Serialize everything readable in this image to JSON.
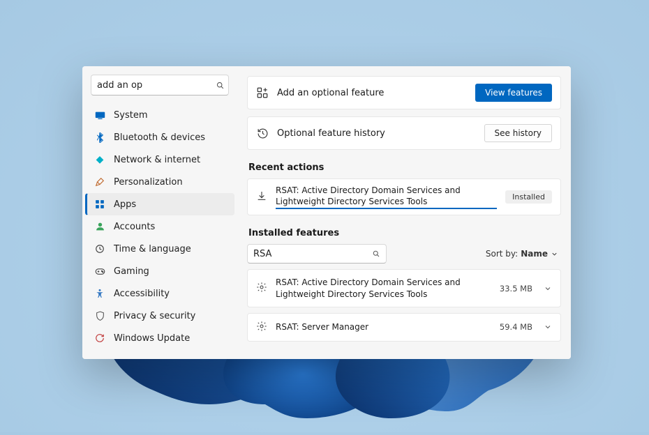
{
  "search_value": "add an op",
  "nav": [
    {
      "icon": "system",
      "label": "System",
      "color": "#0067c0"
    },
    {
      "icon": "bluetooth",
      "label": "Bluetooth & devices",
      "color": "#0067c0"
    },
    {
      "icon": "wifi",
      "label": "Network & internet",
      "color": "#00b0c8"
    },
    {
      "icon": "brush",
      "label": "Personalization",
      "color": "#c06a2e"
    },
    {
      "icon": "apps",
      "label": "Apps",
      "color": "#0067c0"
    },
    {
      "icon": "person",
      "label": "Accounts",
      "color": "#3aa35c"
    },
    {
      "icon": "clock",
      "label": "Time & language",
      "color": "#444"
    },
    {
      "icon": "game",
      "label": "Gaming",
      "color": "#444"
    },
    {
      "icon": "access",
      "label": "Accessibility",
      "color": "#2e74c0"
    },
    {
      "icon": "shield",
      "label": "Privacy & security",
      "color": "#444"
    },
    {
      "icon": "update",
      "label": "Windows Update",
      "color": "#c03a3a"
    }
  ],
  "active_nav_index": 4,
  "add_feature": {
    "label": "Add an optional feature",
    "button": "View features"
  },
  "history": {
    "label": "Optional feature history",
    "button": "See history"
  },
  "recent": {
    "heading": "Recent actions",
    "item": "RSAT: Active Directory Domain Services and Lightweight Directory Services Tools",
    "status": "Installed"
  },
  "installed": {
    "heading": "Installed features",
    "filter_value": "RSA",
    "sort_label": "Sort by:",
    "sort_value": "Name",
    "items": [
      {
        "name": "RSAT: Active Directory Domain Services and Lightweight Directory Services Tools",
        "size": "33.5 MB"
      },
      {
        "name": "RSAT: Server Manager",
        "size": "59.4 MB"
      }
    ]
  }
}
